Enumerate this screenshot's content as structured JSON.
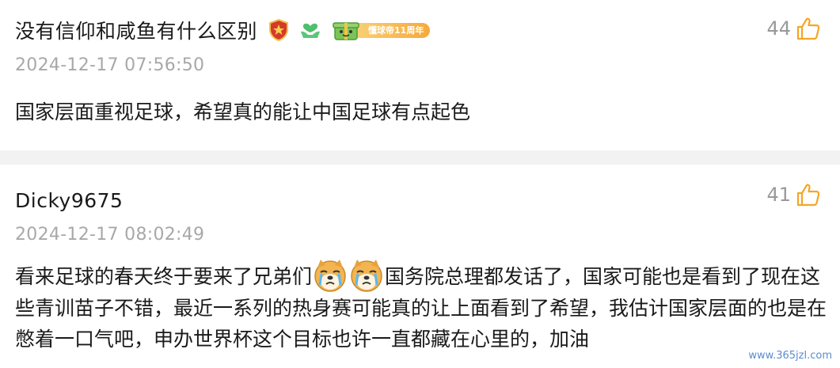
{
  "comments": [
    {
      "author": "没有信仰和咸鱼有什么区别",
      "badges": [
        "shield-badge-icon",
        "charity-badge-icon",
        "anniversary-badge-icon"
      ],
      "anniversary_label": "懂球帝11周年",
      "timestamp": "2024-12-17 07:56:50",
      "likes": "44",
      "content": "国家层面重视足球，希望真的能让中国足球有点起色"
    },
    {
      "author": "Dicky9675",
      "timestamp": "2024-12-17 08:02:49",
      "likes": "41",
      "content_before_emoji": "看来足球的春天终于要来了兄弟们",
      "emoji": [
        "crying-dog-emoji",
        "crying-dog-emoji"
      ],
      "content_after_emoji": "国务院总理都发话了，国家可能也是看到了现在这些青训苗子不错，最近一系列的热身赛可能真的让上面看到了希望，我估计国家层面的也是在憋着一口气吧，申办世界杯这个目标也许一直都藏在心里的，加油"
    }
  ],
  "watermark": "www.365jzl.com",
  "colors": {
    "like_icon": "#f5a623",
    "timestamp": "#a8a8a8",
    "divider": "#f2f2f2"
  }
}
